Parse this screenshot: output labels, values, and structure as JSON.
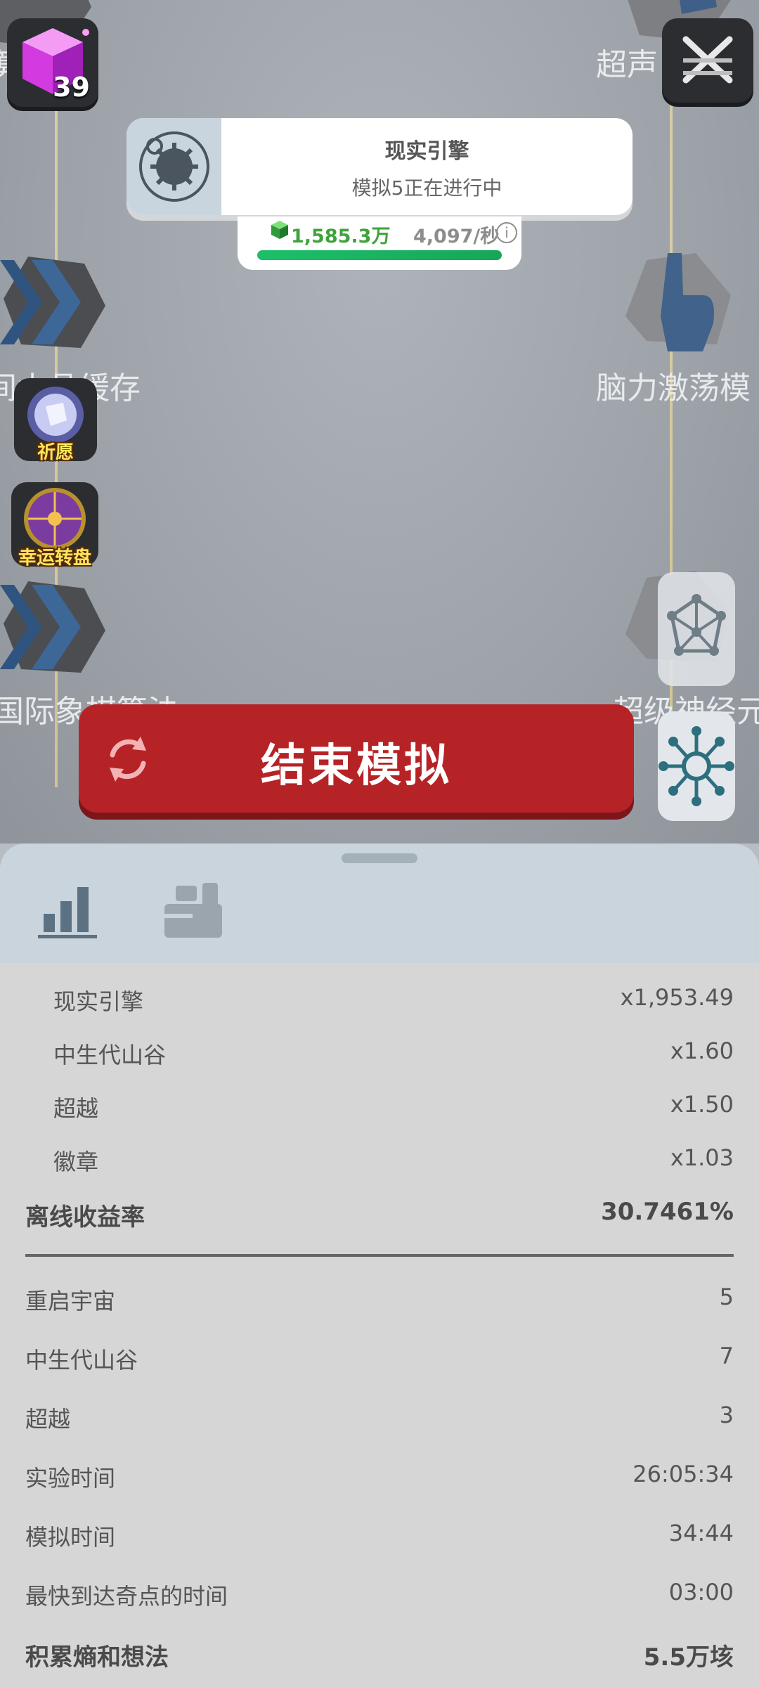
{
  "game": {
    "cube_count": "39",
    "nodes": {
      "top_left": "算",
      "top_right": "超声",
      "mid_left": "间水晶缓存",
      "mid_right": "脑力激荡模",
      "low_left": "国际象棋算法",
      "low_right": "超级神经元"
    },
    "engine_card": {
      "title": "现实引擎",
      "subtitle": "模拟5正在进行中"
    },
    "income": {
      "amount": "1,585.3万",
      "rate": "4,097/秒",
      "info": "i",
      "progress": 1.0
    },
    "side_buttons": {
      "wish": "祈愿",
      "wheel": "幸运转盘"
    },
    "end_button": "结束模拟"
  },
  "panel": {
    "multipliers": [
      {
        "label": "现实引擎",
        "value": "x1,953.49"
      },
      {
        "label": "中生代山谷",
        "value": "x1.60"
      },
      {
        "label": "超越",
        "value": "x1.50"
      },
      {
        "label": "徽章",
        "value": "x1.03"
      }
    ],
    "offline_rate": {
      "label": "离线收益率",
      "value": "30.7461%"
    },
    "stats": [
      {
        "label": "重启宇宙",
        "value": "5"
      },
      {
        "label": "中生代山谷",
        "value": "7"
      },
      {
        "label": "超越",
        "value": "3"
      },
      {
        "label": "实验时间",
        "value": "26:05:34"
      },
      {
        "label": "模拟时间",
        "value": "34:44"
      },
      {
        "label": "最快到达奇点的时间",
        "value": "03:00"
      }
    ],
    "accumulated": {
      "label": "积累熵和想法",
      "value": "5.5万垓"
    }
  },
  "colors": {
    "end_button": "#b62326",
    "progress": "#1dbf6a",
    "income_green": "#3fa33b"
  }
}
